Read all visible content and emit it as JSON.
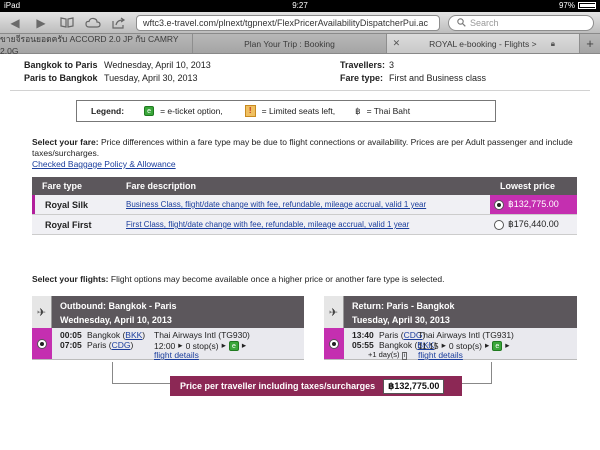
{
  "statusbar": {
    "device": "iPad",
    "time": "9:27",
    "battery": "97%",
    "battery_level": 0.97
  },
  "toolbar": {
    "url": "wftc3.e-travel.com/plnext/tgpnext/FlexPricerAvailabilityDispatcherPui.ac",
    "search_placeholder": "Search"
  },
  "tabs": [
    {
      "label": "ขายจีรอนยอดครับ ACCORD 2.0 JP กับ CAMRY 2.0G"
    },
    {
      "label": "Plan Your Trip : Booking"
    },
    {
      "label": "ROYAL e-booking - Flights >"
    }
  ],
  "trip": {
    "outbound_route": "Bangkok to Paris",
    "outbound_date": "Wednesday, April 10, 2013",
    "return_route": "Paris to Bangkok",
    "return_date": "Tuesday, April 30, 2013",
    "travellers_label": "Travellers:",
    "travellers_value": "3",
    "fare_type_label": "Fare type:",
    "fare_type_value": "First and Business class"
  },
  "legend": {
    "label": "Legend:",
    "eticket_symbol": "e",
    "eticket_text": "= e-ticket option,",
    "limited_text": "= Limited seats left,",
    "baht_symbol": "฿",
    "baht_text": "= Thai Baht"
  },
  "fare_intro": {
    "heading": "Select your fare:",
    "text": "Price differences within a fare type may be due to flight connections or availability. Prices are per Adult passenger and include taxes/surcharges.",
    "baggage_link": "Checked Baggage Policy & Allowance"
  },
  "fare_table": {
    "headers": [
      "Fare type",
      "Fare description",
      "Lowest price"
    ],
    "rows": [
      {
        "type": "Royal Silk",
        "description": "Business Class, flight/date change with fee, refundable, mileage accrual, valid 1 year",
        "price": "฿132,775.00",
        "selected": true
      },
      {
        "type": "Royal First",
        "description": "First Class, flight/date change with fee, refundable, mileage accrual, valid 1 year",
        "price": "฿176,440.00",
        "selected": false
      }
    ]
  },
  "flights_intro": {
    "heading": "Select your flights:",
    "text": "Flight options may become available once a higher price or another fare type is selected."
  },
  "outbound": {
    "title": "Outbound: Bangkok - Paris",
    "date": "Wednesday, April 10, 2013",
    "dep_time": "00:05",
    "dep_city": "Bangkok (",
    "dep_code": "BKK",
    "arr_time": "07:05",
    "arr_city": "Paris (",
    "arr_code": "CDG",
    "airline": "Thai Airways Intl (TG930)",
    "duration": "12:00",
    "stops": "0 stop(s)",
    "details": "flight details"
  },
  "return": {
    "title": "Return: Paris - Bangkok",
    "date": "Tuesday, April 30, 2013",
    "dep_time": "13:40",
    "dep_city": "Paris (",
    "dep_code": "CDG",
    "arr_time": "05:55",
    "arr_city": "Bangkok (",
    "arr_code": "BKK",
    "plus_day": "+1 day(s)",
    "airline": "Thai Airways Intl (TG931)",
    "duration": "11:15",
    "stops": "0 stop(s)",
    "details": "flight details"
  },
  "price_summary": {
    "label": "Price per traveller including taxes/surcharges",
    "amount": "฿132,775.00"
  },
  "colors": {
    "accent": "#c42fb0",
    "header_gray": "#5c575c",
    "price_bar": "#8c2855",
    "link": "#1a3d9c"
  }
}
